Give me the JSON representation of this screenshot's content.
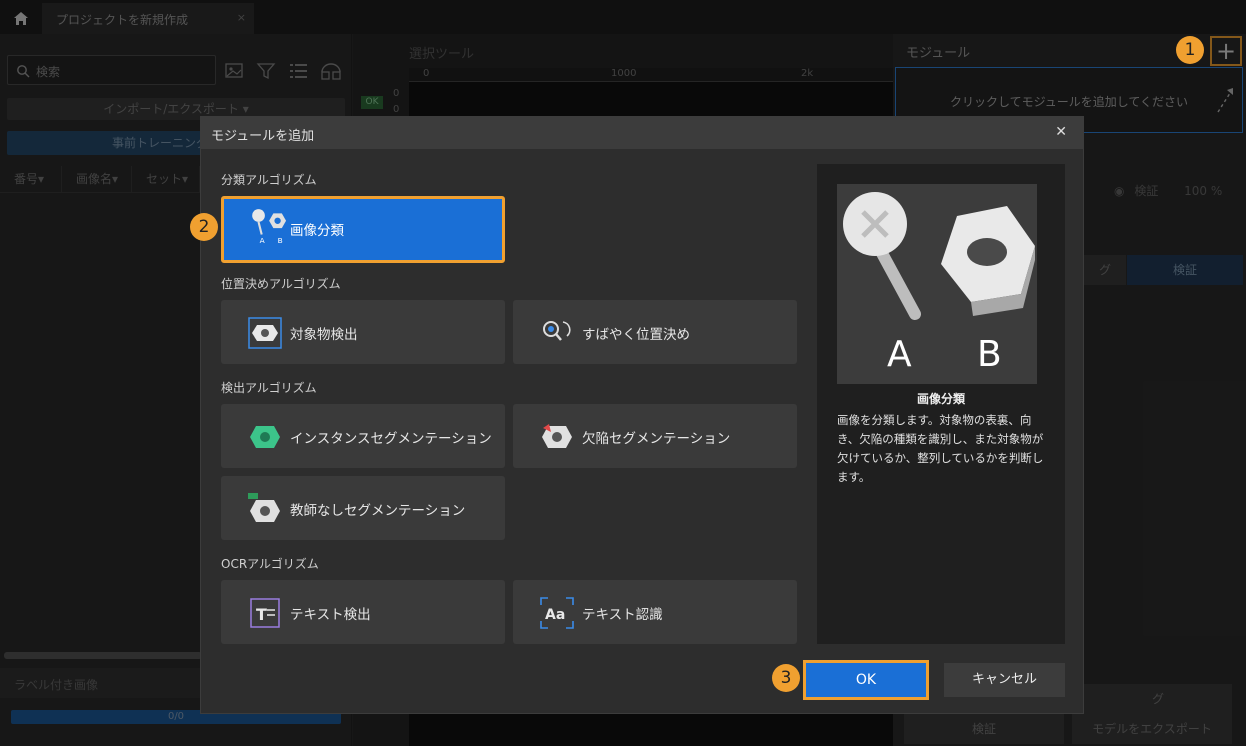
{
  "tabbar": {
    "project_tab": "プロジェクトを新規作成",
    "close_glyph": "×"
  },
  "left": {
    "search_placeholder": "検索",
    "import_export": "インポート/エクスポート ▾",
    "pretrain": "事前トレーニング",
    "columns": [
      "番号▾",
      "画像名▾",
      "セット▾"
    ],
    "labeled_images": "ラベル付き画像",
    "progress_text": "0/0"
  },
  "center": {
    "tool_title": "選択ツール",
    "ruler_ticks": [
      "0",
      "1000",
      "2k"
    ],
    "ok_badge": "OK",
    "v_ticks": [
      "0",
      "0"
    ]
  },
  "right": {
    "title": "モジュール",
    "add_hint": "クリックしてモジュールを追加してください",
    "eye_label": "検証",
    "percent": "100 %",
    "tab_training_partial": "グ",
    "tab_verify": "検証",
    "bottom_training_partial": "グ",
    "bottom_verify": "検証",
    "bottom_export": "モデルをエクスポート"
  },
  "dialog": {
    "title": "モジュールを追加",
    "close": "✕",
    "categories": {
      "classification": "分類アルゴリズム",
      "positioning": "位置決めアルゴリズム",
      "detection": "検出アルゴリズム",
      "ocr": "OCRアルゴリズム"
    },
    "cards": {
      "image_classification": "画像分類",
      "object_detection": "対象物検出",
      "fast_positioning": "すばやく位置決め",
      "instance_segmentation": "インスタンスセグメンテーション",
      "defect_segmentation": "欠陥セグメンテーション",
      "unsupervised_segmentation": "教師なしセグメンテーション",
      "text_detection": "テキスト検出",
      "text_recognition": "テキスト認識"
    },
    "preview": {
      "name": "画像分類",
      "description": "画像を分類します。対象物の表裏、向き、欠陥の種類を識別し、また対象物が欠けているか、整列しているかを判断します。",
      "label_a": "A",
      "label_b": "B"
    },
    "ok": "OK",
    "cancel": "キャンセル"
  },
  "steps": [
    "1",
    "2",
    "3"
  ],
  "colors": {
    "accent_blue": "#1a6fd6",
    "highlight_orange": "#f0a030",
    "dialog_bg": "#2d2d2d",
    "card_bg": "#3a3a3a"
  }
}
